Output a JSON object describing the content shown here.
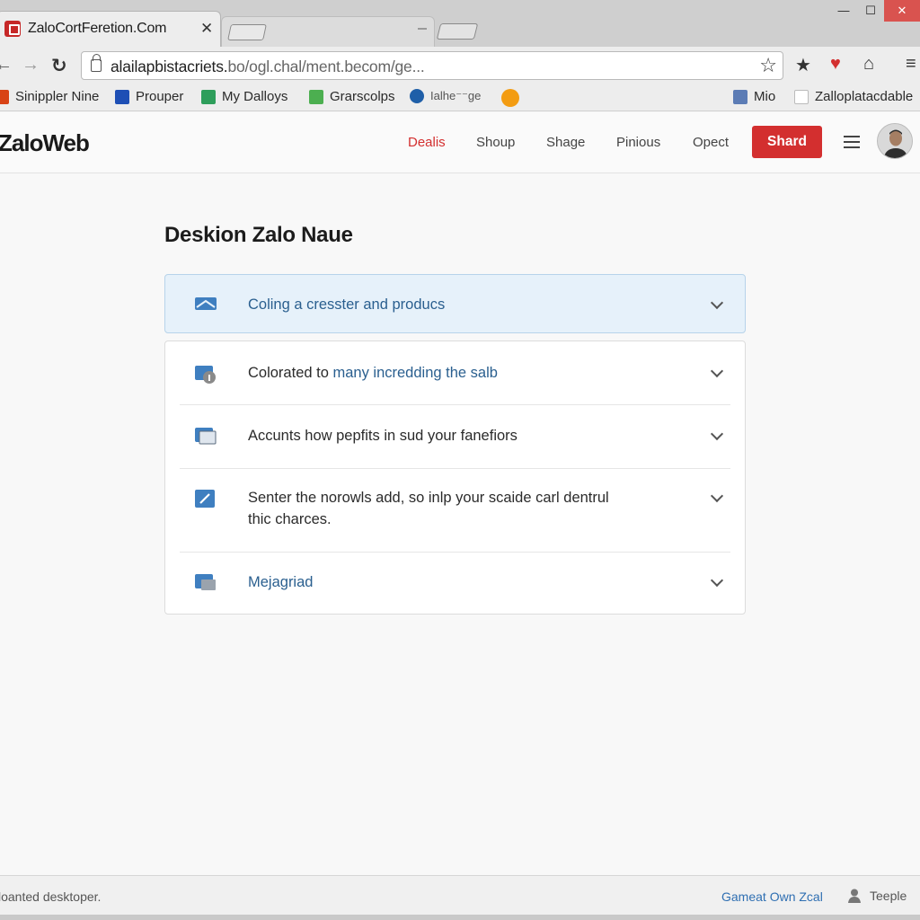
{
  "browser": {
    "tab_title": "ZaloCortFeretion.Com",
    "tab_close": "✕",
    "window_controls": {
      "minimize": "—",
      "maximize": "☐",
      "close": "✕"
    },
    "url_main": "alailapbistacriets.",
    "url_rest": "bo/ogl.chal/ment.becom/ge...",
    "bookmarks_left": [
      {
        "label": "Sinippler Nine",
        "color": "#d84315"
      },
      {
        "label": "Prouper",
        "color": "#1e4fb5"
      },
      {
        "label": "My Dalloys",
        "color": "#2e9e5b"
      },
      {
        "label": "Grarscolps",
        "color": "#4caf50"
      },
      {
        "label": "Ialhe⁻⁻ge",
        "color": "#1f5fa8"
      }
    ],
    "bookmarks_right": [
      {
        "label": "Mio",
        "color": "#5c7cb5"
      },
      {
        "label": "Zalloplatacdable",
        "color": "#e53935"
      }
    ]
  },
  "site": {
    "logo": "ZaloWeb",
    "nav": [
      {
        "label": "Dealis",
        "active": true
      },
      {
        "label": "Shoup",
        "active": false
      },
      {
        "label": "Shage",
        "active": false
      },
      {
        "label": "Pinious",
        "active": false
      },
      {
        "label": "Opect",
        "active": false
      }
    ],
    "share_label": "Shard",
    "accent": "#d32f2f"
  },
  "main": {
    "title": "Deskion Zalo Naue",
    "highlight_item": {
      "label": "Coling a cresster and producs",
      "icon": "inbox-icon"
    },
    "items": [
      {
        "label_a": "Colorated to ",
        "label_b": "many incredding the salb",
        "icon": "folder-info-icon"
      },
      {
        "label_a": "Accunts how pepfits in sud your fanefiors",
        "label_b": "",
        "icon": "window-icon"
      },
      {
        "label_a": "Senter the norowls add, so inlp your scaide carl dentrul",
        "label_b": "thic charces.",
        "icon": "edit-icon"
      },
      {
        "label_a": "Mejagriad",
        "label_b": "",
        "icon": "folder-icon"
      }
    ]
  },
  "status": {
    "left": "loanted desktoper.",
    "link": "Gameat Own Zcal",
    "user": "Teeple"
  }
}
